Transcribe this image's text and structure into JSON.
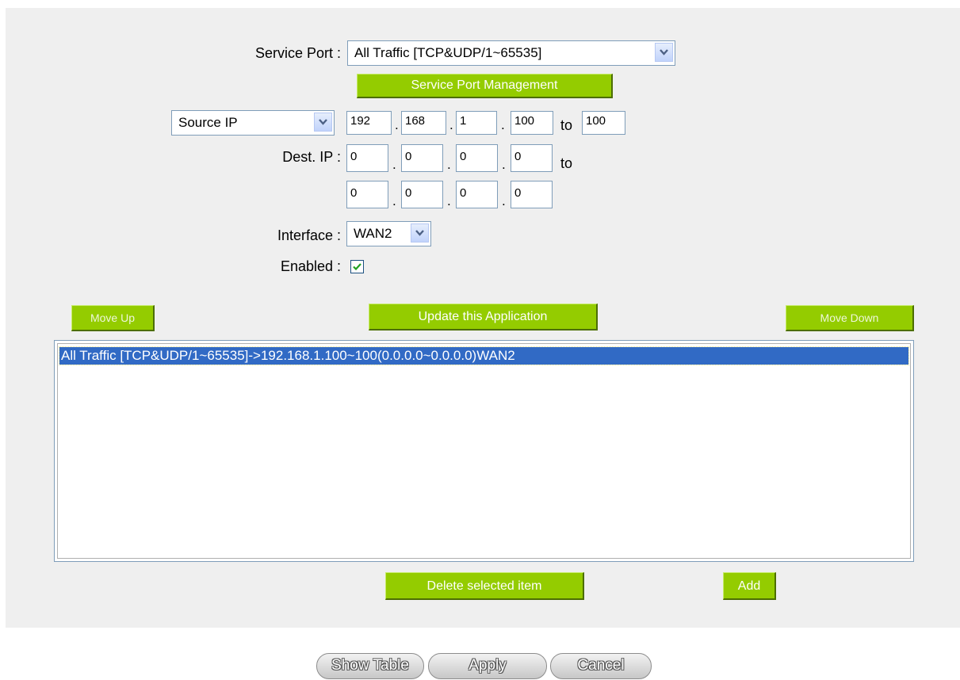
{
  "form": {
    "service_port_label": "Service Port :",
    "service_port_value": "All Traffic [TCP&UDP/1~65535]",
    "service_port_management_label": "Service Port Management",
    "ip_type_value": "Source IP",
    "source_ip": [
      "192",
      "168",
      "1",
      "100"
    ],
    "source_ip_to": "100",
    "to_label": "to",
    "dest_ip_label": "Dest. IP :",
    "dest_ip_start": [
      "0",
      "0",
      "0",
      "0"
    ],
    "dest_ip_end": [
      "0",
      "0",
      "0",
      "0"
    ],
    "dot": ".",
    "interface_label": "Interface :",
    "interface_value": "WAN2",
    "enabled_label": "Enabled :",
    "enabled_checked": true
  },
  "actions": {
    "move_up_label": "Move Up",
    "update_label": "Update this Application",
    "move_down_label": "Move Down",
    "delete_label": "Delete selected item",
    "add_label": "Add"
  },
  "app_list": {
    "items": [
      "All Traffic [TCP&UDP/1~65535]->192.168.1.100~100(0.0.0.0~0.0.0.0)WAN2"
    ]
  },
  "footer": {
    "show_table_label": "Show Table",
    "apply_label": "Apply",
    "cancel_label": "Cancel"
  },
  "colors": {
    "panel_bg": "#efefef",
    "button_green": "#94cc00",
    "selection_blue": "#316ac5",
    "input_border": "#7f9db9"
  },
  "icons": {
    "dropdown": "chevron-down-icon",
    "checkbox": "checkmark-icon"
  }
}
